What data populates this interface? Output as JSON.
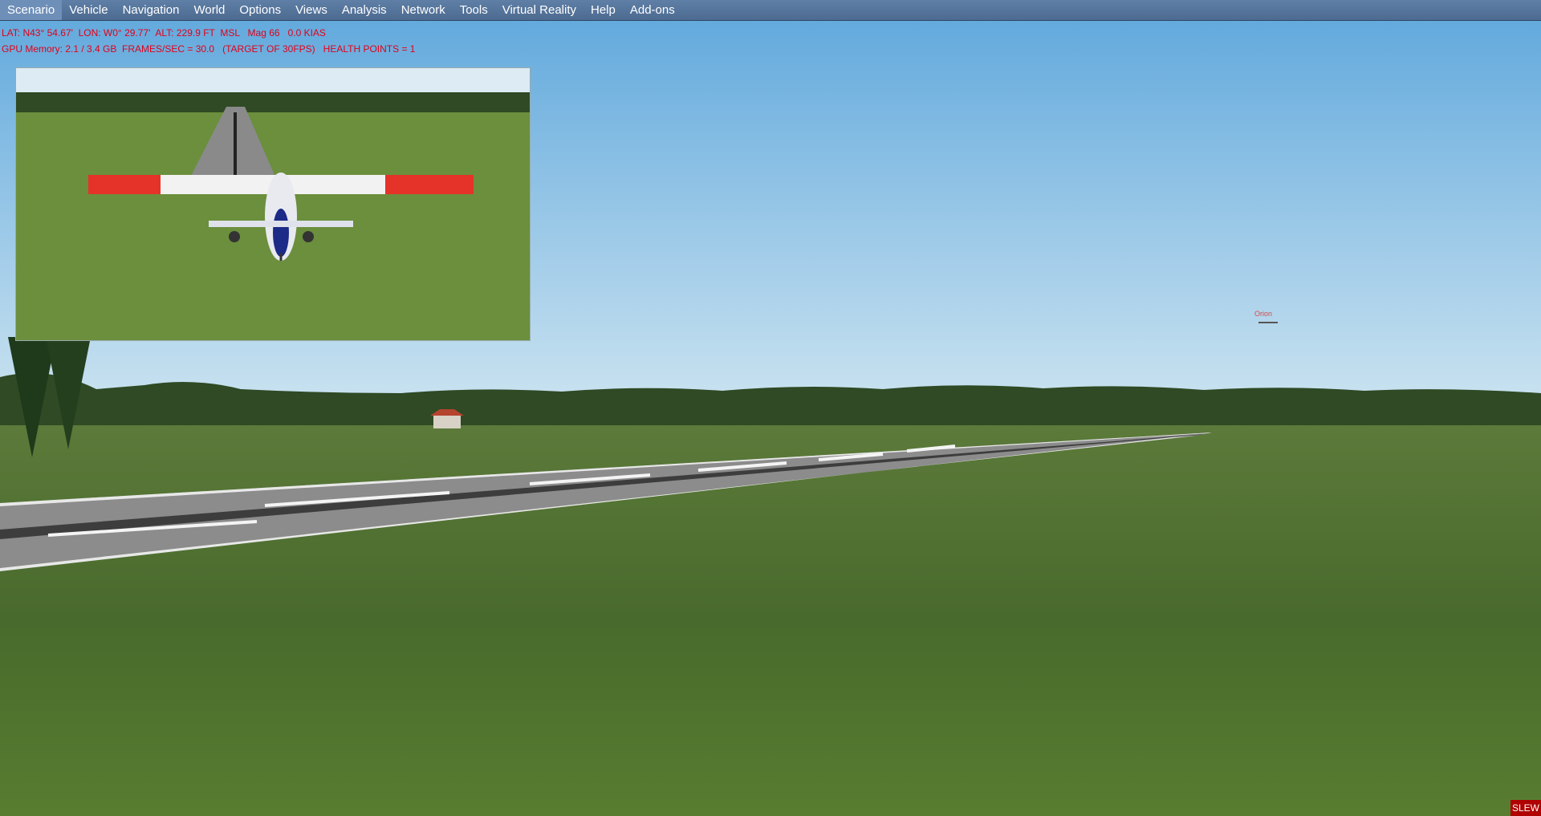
{
  "menubar": {
    "items": [
      {
        "label": "Scenario"
      },
      {
        "label": "Vehicle"
      },
      {
        "label": "Navigation"
      },
      {
        "label": "World"
      },
      {
        "label": "Options"
      },
      {
        "label": "Views"
      },
      {
        "label": "Analysis"
      },
      {
        "label": "Network"
      },
      {
        "label": "Tools"
      },
      {
        "label": "Virtual Reality"
      },
      {
        "label": "Help"
      },
      {
        "label": "Add-ons"
      }
    ]
  },
  "hud": {
    "line1": "LAT: N43° 54.67'  LON: W0° 29.77'  ALT: 229.9 FT  MSL   Mag 66   0.0 KIAS",
    "line2": "GPU Memory: 2.1 / 3.4 GB  FRAMES/SEC = 30.0   (TARGET OF 30FPS)   HEALTH POINTS = 1"
  },
  "ai_traffic_label": "Orion",
  "status": {
    "slew": "SLEW"
  },
  "colors": {
    "menubar": "#4d6b91",
    "hud_text": "#e2001a",
    "sky_top": "#6aaed9",
    "grass": "#4f6e2a"
  }
}
